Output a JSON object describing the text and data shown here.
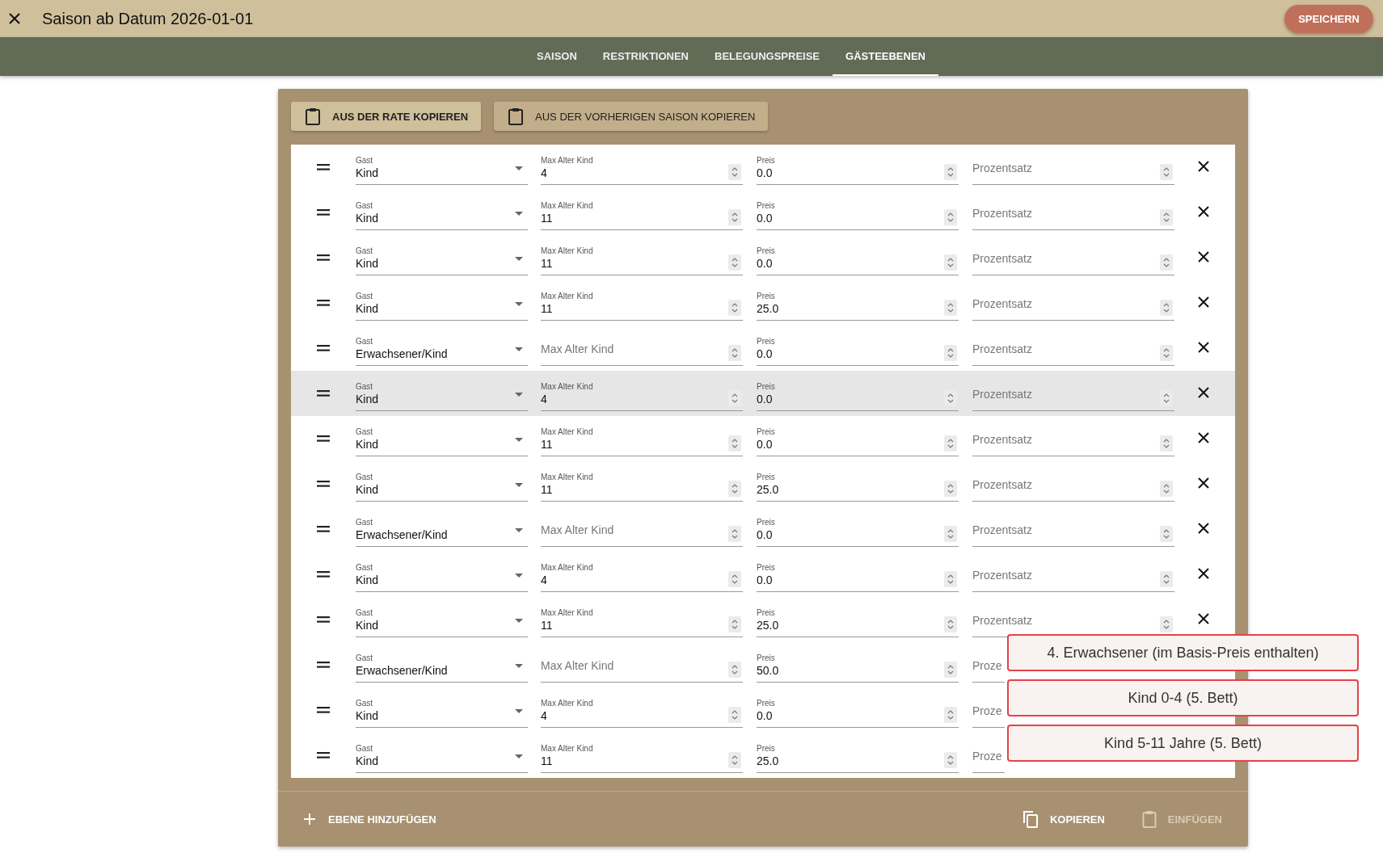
{
  "title": "Saison ab Datum 2026-01-01",
  "save_button": "SPEICHERN",
  "tabs": [
    {
      "label": "SAISON",
      "selected": false
    },
    {
      "label": "RESTRIKTIONEN",
      "selected": false
    },
    {
      "label": "BELEGUNGSPREISE",
      "selected": false
    },
    {
      "label": "GÄSTEEBENEN",
      "selected": true
    }
  ],
  "copy_buttons": [
    {
      "label": "AUS DER RATE KOPIEREN",
      "kind": "primary"
    },
    {
      "label": "AUS DER VORHERIGEN SAISON KOPIEREN",
      "kind": "secondary"
    }
  ],
  "rows": [
    {
      "guest_label": "Gast",
      "guest": "Kind",
      "age_label": "Max Alter Kind",
      "age": "4",
      "price_label": "Preis",
      "price": "0.0",
      "percent": "Prozentsatz",
      "highlighted": false
    },
    {
      "guest_label": "Gast",
      "guest": "Kind",
      "age_label": "Max Alter Kind",
      "age": "11",
      "price_label": "Preis",
      "price": "0.0",
      "percent": "Prozentsatz",
      "highlighted": false
    },
    {
      "guest_label": "Gast",
      "guest": "Kind",
      "age_label": "Max Alter Kind",
      "age": "11",
      "price_label": "Preis",
      "price": "0.0",
      "percent": "Prozentsatz",
      "highlighted": false
    },
    {
      "guest_label": "Gast",
      "guest": "Kind",
      "age_label": "Max Alter Kind",
      "age": "11",
      "price_label": "Preis",
      "price": "25.0",
      "percent": "Prozentsatz",
      "highlighted": false
    },
    {
      "guest_label": "Gast",
      "guest": "Erwachsener/Kind",
      "age_label": "Max Alter Kind",
      "price_label": "Preis",
      "price": "0.0",
      "percent": "Prozentsatz",
      "highlighted": false
    },
    {
      "guest_label": "Gast",
      "guest": "Kind",
      "age_label": "Max Alter Kind",
      "age": "4",
      "price_label": "Preis",
      "price": "0.0",
      "percent": "Prozentsatz",
      "highlighted": true
    },
    {
      "guest_label": "Gast",
      "guest": "Kind",
      "age_label": "Max Alter Kind",
      "age": "11",
      "price_label": "Preis",
      "price": "0.0",
      "percent": "Prozentsatz",
      "highlighted": false
    },
    {
      "guest_label": "Gast",
      "guest": "Kind",
      "age_label": "Max Alter Kind",
      "age": "11",
      "price_label": "Preis",
      "price": "25.0",
      "percent": "Prozentsatz",
      "highlighted": false
    },
    {
      "guest_label": "Gast",
      "guest": "Erwachsener/Kind",
      "age_label": "Max Alter Kind",
      "price_label": "Preis",
      "price": "0.0",
      "percent": "Prozentsatz",
      "highlighted": false
    },
    {
      "guest_label": "Gast",
      "guest": "Kind",
      "age_label": "Max Alter Kind",
      "age": "4",
      "price_label": "Preis",
      "price": "0.0",
      "percent": "Prozentsatz",
      "highlighted": false
    },
    {
      "guest_label": "Gast",
      "guest": "Kind",
      "age_label": "Max Alter Kind",
      "age": "11",
      "price_label": "Preis",
      "price": "25.0",
      "percent": "Prozentsatz",
      "highlighted": false
    },
    {
      "guest_label": "Gast",
      "guest": "Erwachsener/Kind",
      "age_label": "Max Alter Kind",
      "price_label": "Preis",
      "price": "50.0",
      "percent": "Proze",
      "highlighted": false
    },
    {
      "guest_label": "Gast",
      "guest": "Kind",
      "age_label": "Max Alter Kind",
      "age": "4",
      "price_label": "Preis",
      "price": "0.0",
      "percent": "Proze",
      "highlighted": false
    },
    {
      "guest_label": "Gast",
      "guest": "Kind",
      "age_label": "Max Alter Kind",
      "age": "11",
      "price_label": "Preis",
      "price": "25.0",
      "percent": "Proze",
      "highlighted": false
    }
  ],
  "callouts": [
    "4. Erwachsener (im Basis-Preis enthalten)",
    "Kind 0-4 (5. Bett)",
    "Kind 5-11 Jahre (5. Bett)"
  ],
  "footer": {
    "add": "EBENE HINZUFÜGEN",
    "actions": [
      {
        "label": "KOPIEREN",
        "kind": "copy",
        "disabled": false
      },
      {
        "label": "EINFÜGEN",
        "kind": "paste",
        "disabled": true
      }
    ]
  }
}
